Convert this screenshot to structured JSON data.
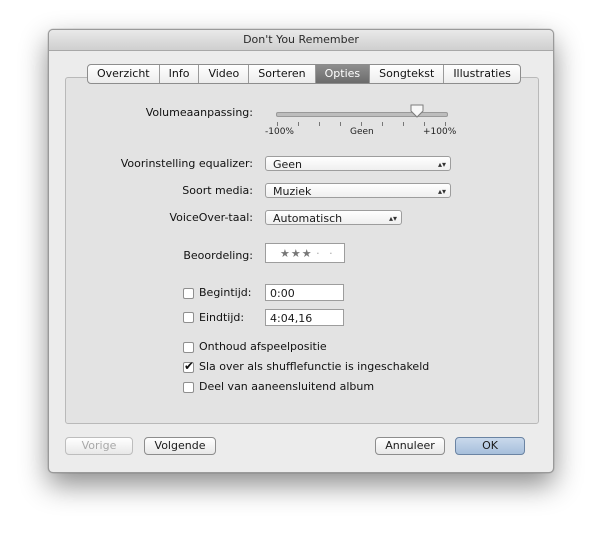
{
  "window": {
    "title": "Don't You Remember"
  },
  "tabs": [
    {
      "label": "Overzicht"
    },
    {
      "label": "Info"
    },
    {
      "label": "Video"
    },
    {
      "label": "Sorteren"
    },
    {
      "label": "Opties",
      "active": true
    },
    {
      "label": "Songtekst"
    },
    {
      "label": "Illustraties"
    }
  ],
  "volume": {
    "label": "Volumeaanpassing:",
    "min_label": "-100%",
    "mid_label": "Geen",
    "max_label": "+100%",
    "value_fraction": 0.83
  },
  "equalizer": {
    "label": "Voorinstelling equalizer:",
    "value": "Geen"
  },
  "media": {
    "label": "Soort media:",
    "value": "Muziek"
  },
  "voiceover": {
    "label": "VoiceOver-taal:",
    "value": "Automatisch"
  },
  "rating": {
    "label": "Beoordeling:",
    "stars": "★★★",
    "empty": "· ·",
    "value": 3,
    "max": 5
  },
  "start": {
    "label": "Begintijd:",
    "value": "0:00",
    "checked": false
  },
  "stop": {
    "label": "Eindtijd:",
    "value": "4:04,16",
    "checked": false
  },
  "options": {
    "remember": {
      "label": "Onthoud afspeelpositie",
      "checked": false
    },
    "skip": {
      "label": "Sla over als shufflefunctie is ingeschakeld",
      "checked": true
    },
    "gapless": {
      "label": "Deel van aaneensluitend album",
      "checked": false
    }
  },
  "buttons": {
    "prev": "Vorige",
    "next": "Volgende",
    "cancel": "Annuleer",
    "ok": "OK"
  },
  "colors": {
    "active_tab": "#7a7a7a",
    "ok_button": "#b4c9e2"
  }
}
